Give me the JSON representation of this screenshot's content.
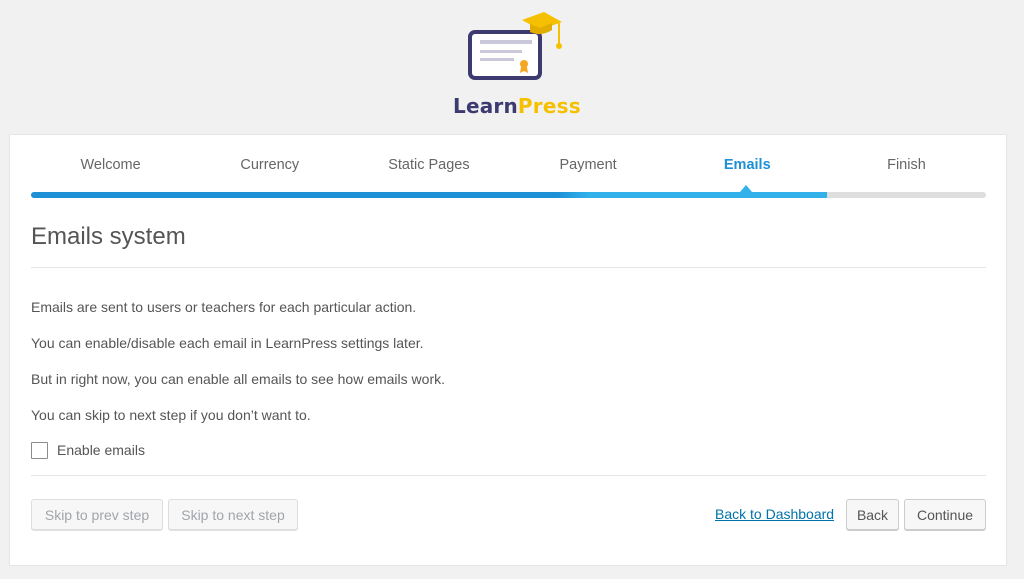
{
  "brand": {
    "logo_part1": "Learn",
    "logo_part2": "Press",
    "colors": {
      "primary": "#3d3a6f",
      "accent": "#f5c000",
      "active": "#1e90d6"
    }
  },
  "steps": [
    {
      "label": "Welcome",
      "active": false
    },
    {
      "label": "Currency",
      "active": false
    },
    {
      "label": "Static Pages",
      "active": false
    },
    {
      "label": "Payment",
      "active": false
    },
    {
      "label": "Emails",
      "active": true
    },
    {
      "label": "Finish",
      "active": false
    }
  ],
  "progress": {
    "completed_fraction": 0.833
  },
  "page": {
    "title": "Emails system",
    "paragraphs": [
      "Emails are sent to users or teachers for each particular action.",
      "You can enable/disable each email in LearnPress settings later.",
      "But in right now, you can enable all emails to see how emails work.",
      "You can skip to next step if you don’t want to."
    ],
    "checkbox": {
      "label": "Enable emails",
      "checked": false
    }
  },
  "footer": {
    "skip_prev": "Skip to prev step",
    "skip_next": "Skip to next step",
    "dashboard_link": "Back to Dashboard",
    "back": "Back",
    "continue": "Continue"
  }
}
